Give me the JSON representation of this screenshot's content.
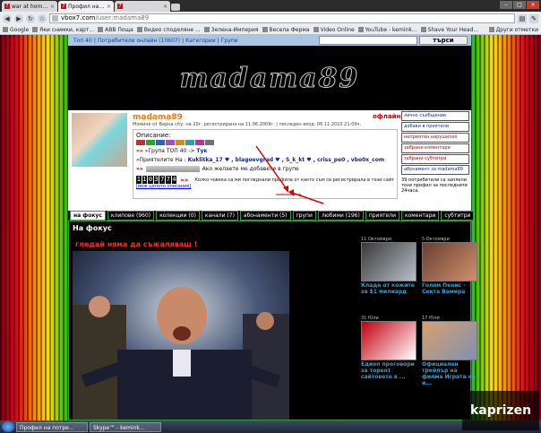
{
  "browser": {
    "tabs": [
      {
        "label": "war at home / търсен...",
        "active": false
      },
      {
        "label": "Профил на потребите...",
        "active": true
      },
      {
        "label": "",
        "active": false
      }
    ],
    "url_domain": "vbox7.com",
    "url_path": "/user:madama89",
    "bookmarks": [
      "Google",
      "Яки снимки, карт...",
      "ABB Поща",
      "Видео споделяне ...",
      "Зелена-Империя",
      "Весела Ферма",
      "Video Online",
      "YouTube - kemink...",
      "Shave Your Head..."
    ],
    "bookmarks_more": "Други отметки"
  },
  "site": {
    "nav": [
      "Топ 40",
      "Потребители онлайн (10607)",
      "Категории",
      "Групи"
    ],
    "search_button": "търси",
    "logo": "madama89"
  },
  "profile": {
    "username": "madama89",
    "status": "офлайн",
    "meta": "Момиче от Варна city, на 20г. регистрирана на 11.06.2009г. | последен вход: 06.11.2010 21:09ч.",
    "desc_label": "Описание:",
    "group_line_prefix": "»Група ТОП 40 ->",
    "group_line_name": "Тук",
    "friends_prefix": "»Приятелите На :",
    "friends": "Kuklitka_17 ♥ , blagoevgrad ♥ , S_k_kt ♥ , criss_pe0 , vbo0x_com",
    "add_group_text": "Ако желаете ме добавете в групе",
    "counter_digits": [
      "1",
      "1",
      "0",
      "3",
      "7",
      "7",
      "4"
    ],
    "counter_text": "Колко човека са ми погледнали профила от както съм се регистрирала в този сайт",
    "full_desc_link": "[виж цялото описание]",
    "actions": [
      {
        "label": "лично съобщение",
        "color": "#0033aa"
      },
      {
        "label": "добави в приятели",
        "color": "#0033aa"
      },
      {
        "label": "неприятен нарушител",
        "color": "#c00000"
      },
      {
        "label": "забрани коментари",
        "color": "#c00000"
      },
      {
        "label": "забрани субтитри",
        "color": "#c00000"
      },
      {
        "label": "абонамент за madama89",
        "color": "#0033aa"
      }
    ],
    "action_note": "39 потребители са заплели този профил за последните 24часа."
  },
  "tabs": [
    "на фокус",
    "клипове (960)",
    "колекции (0)",
    "канали (7)",
    "абонаменти (5)",
    "групи",
    "любими (196)",
    "приятели",
    "коментари",
    "субтитри"
  ],
  "content": {
    "section_title": "На фокус",
    "featured_title": "гледай няма да съжаляваш !",
    "thumbs": [
      {
        "date": "11 Октомври",
        "caption": "Кладе от кожите за $1 милиард",
        "colors": [
          "#3a3a3a",
          "#b8c0c8"
        ]
      },
      {
        "date": "5 Октомври",
        "caption": "Голям Пенис - Секта Вамира",
        "colors": [
          "#6a4030",
          "#d09070"
        ]
      },
      {
        "date": "31 Юли",
        "caption": "Едиоп проговори за торент сайтовете в ...",
        "colors": [
          "#c00010",
          "#fff"
        ]
      },
      {
        "date": "17 Юли",
        "caption": "Официален трейлър на филма Играта на и...",
        "colors": [
          "#d8a070",
          "#8090b0"
        ]
      }
    ]
  },
  "taskbar": {
    "tasks": [
      "Профил на потре...",
      "Skype™ - kemink..."
    ],
    "tray": ""
  },
  "watermark": "kaprizen"
}
